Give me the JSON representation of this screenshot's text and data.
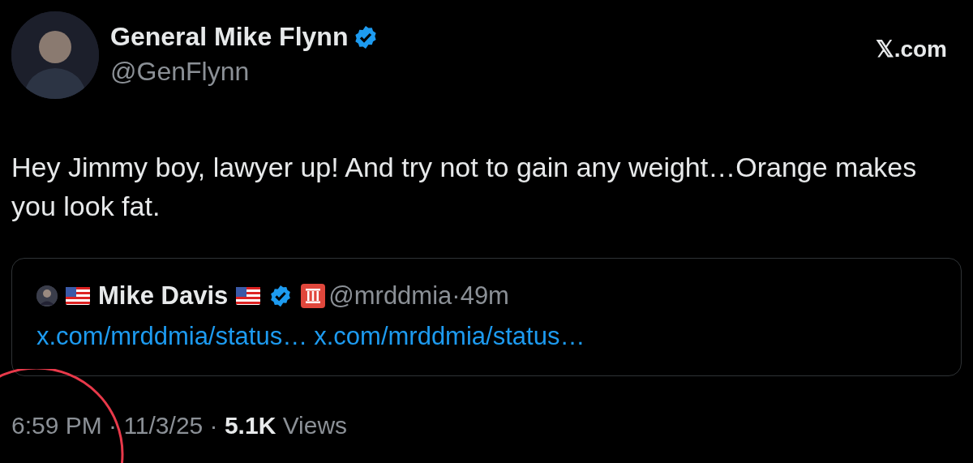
{
  "author": {
    "name": "General Mike Flynn",
    "handle": "@GenFlynn",
    "verified": true
  },
  "site": "𝕏.com",
  "text": "Hey Jimmy boy, lawyer up! And try not to gain any weight…Orange makes you look fat.",
  "quote": {
    "name": "Mike Davis",
    "verified": true,
    "handle_time": "@mrddmia·49m",
    "links": [
      "x.com/mrddmia/status…",
      "x.com/mrddmia/status…"
    ]
  },
  "meta": "6:59 PM · 11/3/25 · **5.1K** Views",
  "annotation": {
    "kind": "circle"
  }
}
